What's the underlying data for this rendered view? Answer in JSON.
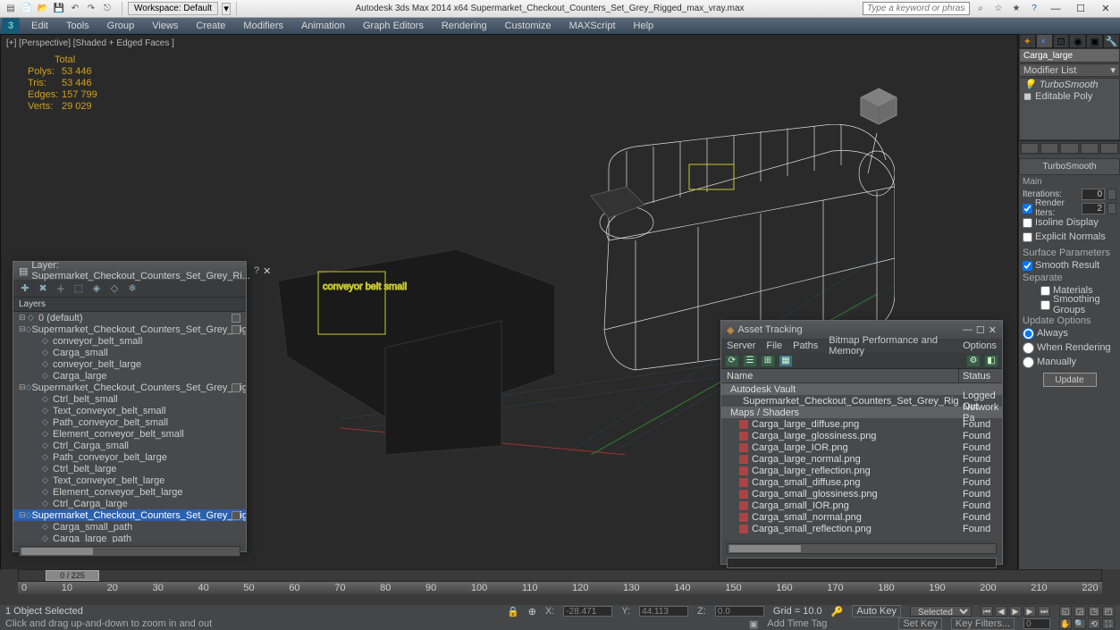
{
  "title": "Autodesk 3ds Max  2014 x64       Supermarket_Checkout_Counters_Set_Grey_Rigged_max_vray.max",
  "workspace": {
    "label": "Workspace: Default"
  },
  "search_placeholder": "Type a keyword or phrase",
  "menus": [
    "Edit",
    "Tools",
    "Group",
    "Views",
    "Create",
    "Modifiers",
    "Animation",
    "Graph Editors",
    "Rendering",
    "Customize",
    "MAXScript",
    "Help"
  ],
  "viewport_label": "[+] [Perspective] [Shaded + Edged Faces ]",
  "stats": {
    "header": "Total",
    "rows": [
      {
        "l": "Polys:",
        "v": "53 446"
      },
      {
        "l": "Tris:",
        "v": "53 446"
      },
      {
        "l": "Edges:",
        "v": "157 799"
      },
      {
        "l": "Verts:",
        "v": "29 029"
      }
    ]
  },
  "layer_dialog": {
    "title": "Layer: Supermarket_Checkout_Counters_Set_Grey_Ri...",
    "header": "Layers",
    "items": [
      {
        "d": 0,
        "exp": "⊟",
        "txt": "0 (default)",
        "chk": true
      },
      {
        "d": 0,
        "exp": "⊟",
        "txt": "Supermarket_Checkout_Counters_Set_Grey_Rigged",
        "chk": true
      },
      {
        "d": 1,
        "txt": "conveyor_belt_small"
      },
      {
        "d": 1,
        "txt": "Carga_small"
      },
      {
        "d": 1,
        "txt": "conveyor_belt_large"
      },
      {
        "d": 1,
        "txt": "Carga_large"
      },
      {
        "d": 0,
        "exp": "⊟",
        "txt": "Supermarket_Checkout_Counters_Set_Grey_Rigged_controllers",
        "chk": true
      },
      {
        "d": 1,
        "txt": "Ctrl_belt_small"
      },
      {
        "d": 1,
        "txt": "Text_conveyor_belt_small"
      },
      {
        "d": 1,
        "txt": "Path_conveyor_belt_small"
      },
      {
        "d": 1,
        "txt": "Element_conveyor_belt_small"
      },
      {
        "d": 1,
        "txt": "Ctrl_Carga_small"
      },
      {
        "d": 1,
        "txt": "Path_conveyor_belt_large"
      },
      {
        "d": 1,
        "txt": "Ctrl_belt_large"
      },
      {
        "d": 1,
        "txt": "Text_conveyor_belt_large"
      },
      {
        "d": 1,
        "txt": "Element_conveyor_belt_large"
      },
      {
        "d": 1,
        "txt": "Ctrl_Carga_large"
      },
      {
        "d": 0,
        "exp": "⊟",
        "txt": "Supermarket_Checkout_Counters_Set_Grey_Rigged_helpers",
        "sel": true,
        "chk": true
      },
      {
        "d": 1,
        "txt": "Carga_small_path"
      },
      {
        "d": 1,
        "txt": "Carga_large_path"
      }
    ]
  },
  "asset_dialog": {
    "title": "Asset Tracking",
    "menu": [
      "Server",
      "File",
      "Paths",
      "Bitmap Performance and Memory",
      "Options"
    ],
    "cols": {
      "name": "Name",
      "status": "Status"
    },
    "items": [
      {
        "cat": true,
        "n": "Autodesk Vault"
      },
      {
        "n": "Supermarket_Checkout_Counters_Set_Grey_Rigged_max_vray.max",
        "s": "Logged Out",
        "fi": "#8a8"
      },
      {
        "cat": true,
        "n": "Maps / Shaders",
        "s": "Network Pa"
      },
      {
        "n": "Carga_large_diffuse.png",
        "s": "Found",
        "fi": "#a44"
      },
      {
        "n": "Carga_large_glossiness.png",
        "s": "Found",
        "fi": "#a44"
      },
      {
        "n": "Carga_large_IOR.png",
        "s": "Found",
        "fi": "#a44"
      },
      {
        "n": "Carga_large_normal.png",
        "s": "Found",
        "fi": "#a44"
      },
      {
        "n": "Carga_large_reflection.png",
        "s": "Found",
        "fi": "#a44"
      },
      {
        "n": "Carga_small_diffuse.png",
        "s": "Found",
        "fi": "#a44"
      },
      {
        "n": "Carga_small_glossiness.png",
        "s": "Found",
        "fi": "#a44"
      },
      {
        "n": "Carga_small_IOR.png",
        "s": "Found",
        "fi": "#a44"
      },
      {
        "n": "Carga_small_normal.png",
        "s": "Found",
        "fi": "#a44"
      },
      {
        "n": "Carga_small_reflection.png",
        "s": "Found",
        "fi": "#a44"
      }
    ]
  },
  "cmd": {
    "obj": "Carga_large",
    "modlist": "Modifier List",
    "stack": [
      "TurboSmooth",
      "Editable Poly"
    ],
    "rollout": "TurboSmooth",
    "main": "Main",
    "iterations": {
      "l": "Iterations:",
      "v": "0"
    },
    "render_iters": {
      "l": "Render Iters:",
      "v": "2"
    },
    "isoline": "Isoline Display",
    "explicit": "Explicit Normals",
    "surf": "Surface Parameters",
    "smooth": "Smooth Result",
    "separate": "Separate",
    "materials": "Materials",
    "smoothing_groups": "Smoothing Groups",
    "update_opts": "Update Options",
    "always": "Always",
    "when_rendering": "When Rendering",
    "manually": "Manually",
    "update_btn": "Update"
  },
  "timeline": {
    "handle": "0 / 225",
    "ticks": [
      "0",
      "10",
      "20",
      "30",
      "40",
      "50",
      "60",
      "70",
      "80",
      "90",
      "100",
      "110",
      "120",
      "130",
      "140",
      "150",
      "160",
      "170",
      "180",
      "190",
      "200",
      "210",
      "220"
    ]
  },
  "status": {
    "sel": "1 Object Selected",
    "x": "-28.471",
    "y": "44.113",
    "z": "0.0",
    "grid": "Grid = 10.0",
    "autokey": "Auto Key",
    "setkey": "Set Key",
    "selected": "Selected",
    "keyfilters": "Key Filters...",
    "hint": "Click and drag up-and-down to zoom in and out",
    "addtag": "Add Time Tag"
  },
  "vp_labels": {
    "belt": "conveyor belt small"
  }
}
